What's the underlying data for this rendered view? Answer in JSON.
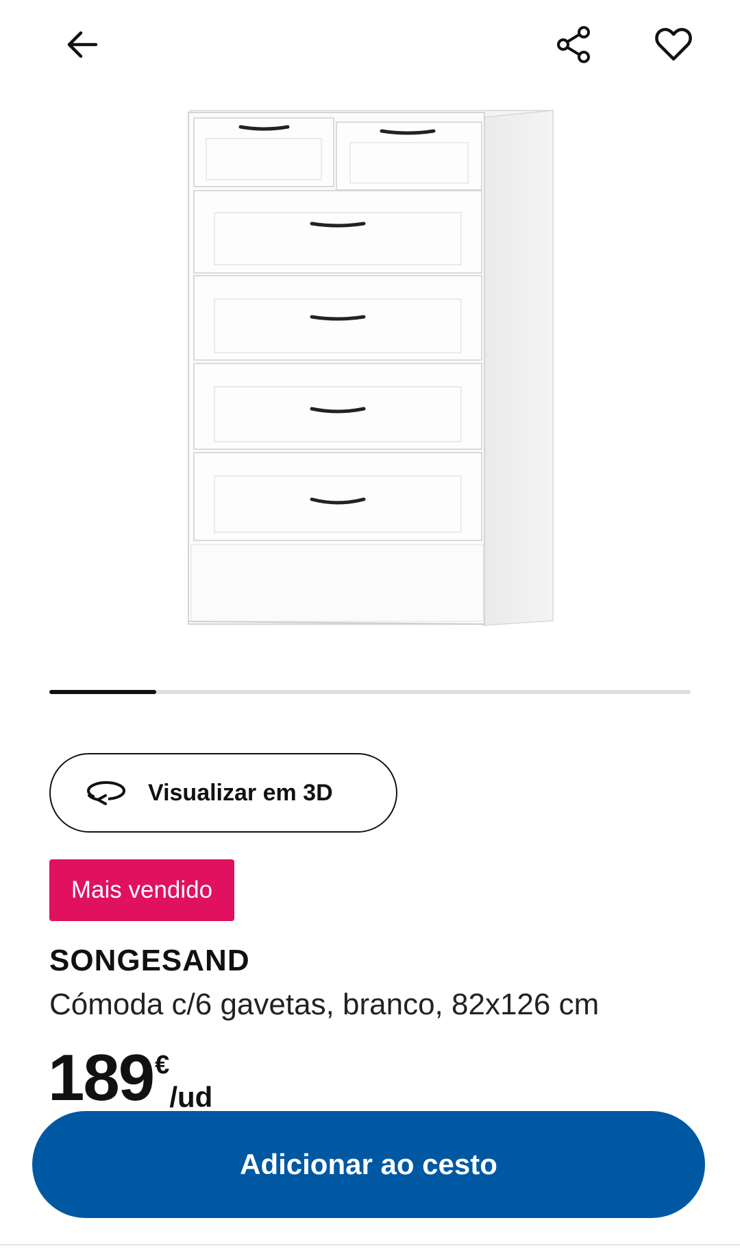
{
  "header": {
    "back_icon": "arrow-left-icon",
    "share_icon": "share-icon",
    "favourite_icon": "heart-outline-icon"
  },
  "carousel": {
    "current": 1,
    "total": 6
  },
  "view3d": {
    "label": "Visualizar em 3D",
    "icon": "rotate-3d-icon"
  },
  "badge": {
    "label": "Mais vendido",
    "color": "#e0115f"
  },
  "product": {
    "name": "SONGESAND",
    "description": "Cómoda c/6 gavetas, branco, 82x126 cm",
    "price": "189",
    "currency": "€",
    "unit": "/ud"
  },
  "cta": {
    "label": "Adicionar ao cesto",
    "color": "#0058a3"
  }
}
